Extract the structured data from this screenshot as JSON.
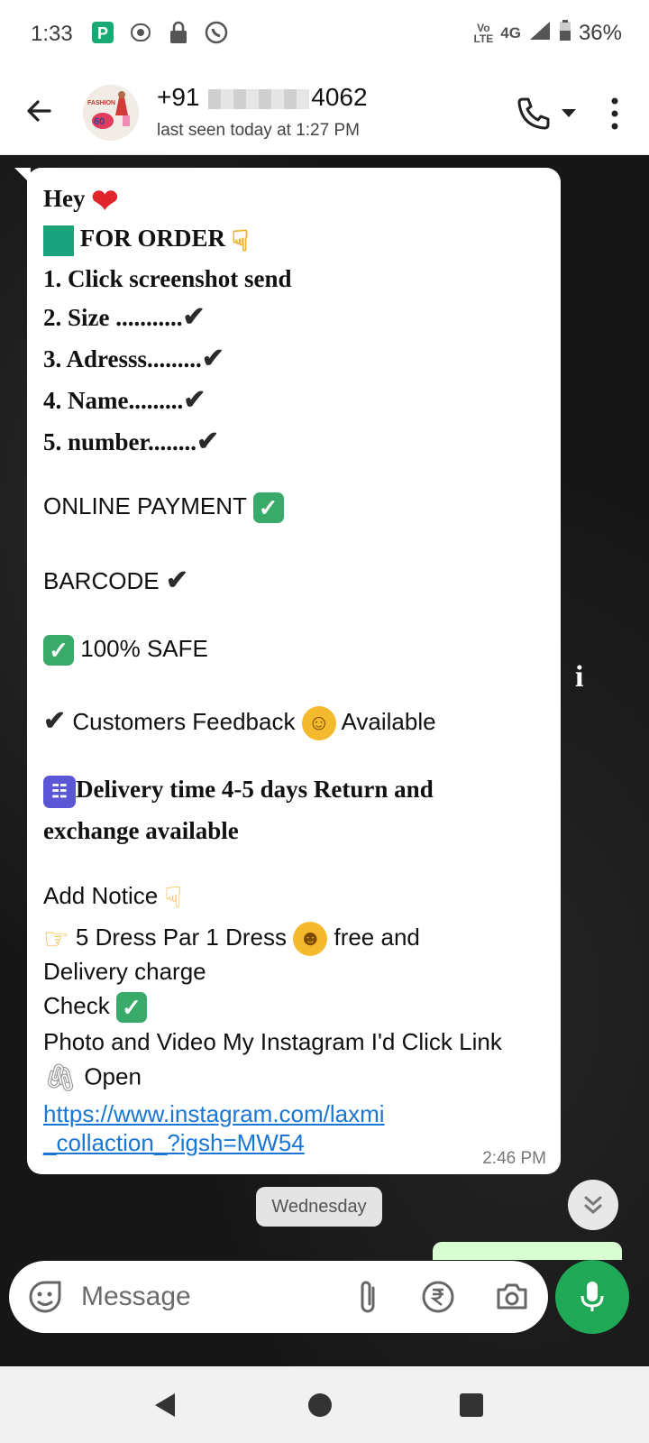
{
  "status_bar": {
    "time": "1:33",
    "network_top": "Vo",
    "network_bottom": "LTE",
    "network_type": "4G",
    "battery": "36%"
  },
  "header": {
    "contact_prefix": "+91",
    "contact_suffix": "4062",
    "last_seen": "last seen today at 1:27 PM",
    "avatar_text_top": "FASHION",
    "avatar_text_number": "60"
  },
  "message": {
    "lines": {
      "hey": "Hey",
      "for_order": "FOR ORDER",
      "item1": "1. Click screenshot send",
      "item2": "2. Size ...........",
      "item3": "3. Adresss.........",
      "item4": "4. Name.........",
      "item5": "5. number........",
      "online_payment": "ONLINE PAYMENT",
      "barcode": "BARCODE",
      "safe": "100% SAFE",
      "feedback_a": "Customers Feedback",
      "feedback_b": "Available",
      "delivery": "Delivery time 4-5 days  Return and",
      "delivery2": "exchange available",
      "notice": "Add Notice",
      "offer": "5 Dress Par 1 Dress",
      "offer_b": "free and",
      "delivery_charge": "Delivery charge",
      "check": "Check",
      "photo_video": "Photo and Video My Instagram I'd Click Link",
      "open": "Open",
      "link1": "https://www.instagram.com/laxmi",
      "link2": "_collaction_?igsh=MW54"
    },
    "timestamp": "2:46 PM"
  },
  "date_chip": "Wednesday",
  "info_glyph": "i",
  "composer": {
    "placeholder": "Message"
  },
  "colors": {
    "accent_green": "#1fa855",
    "link_blue": "#1976d2",
    "bubble": "#ffffff",
    "outgoing_bubble": "#d9fdd3"
  },
  "icons": [
    "back-arrow-icon",
    "phone-icon",
    "caret-down-icon",
    "more-vert-icon",
    "emoji-sticker-icon",
    "paperclip-icon",
    "rupee-icon",
    "camera-icon",
    "mic-icon",
    "nav-back-icon",
    "nav-home-icon",
    "nav-recents-icon",
    "scroll-down-icon"
  ]
}
